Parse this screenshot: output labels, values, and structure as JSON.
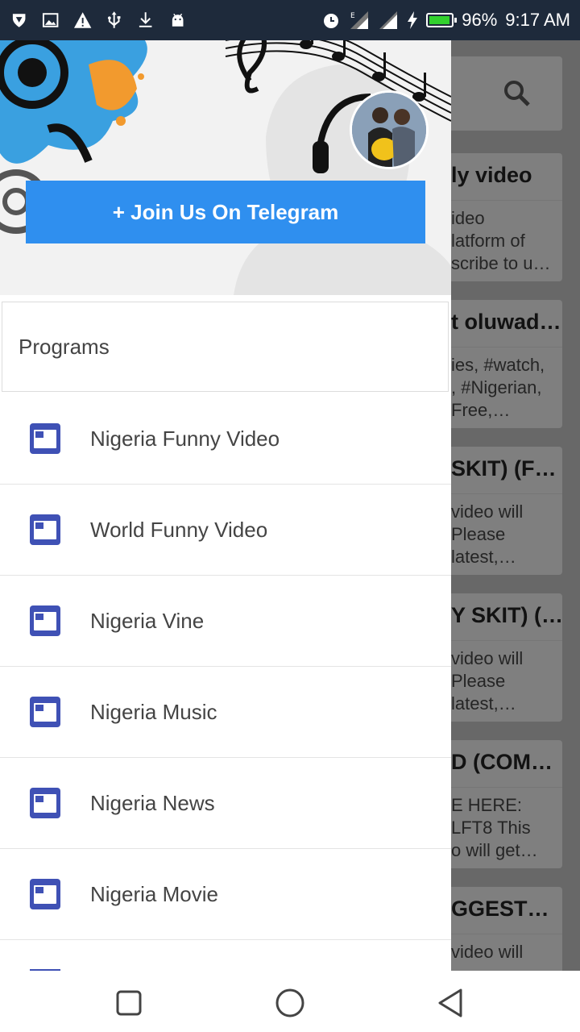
{
  "status_bar": {
    "battery_percent": "96%",
    "battery_level": 0.96,
    "time": "9:17 AM",
    "icons": [
      "vpn-icon",
      "image-icon",
      "warning-icon",
      "usb-icon",
      "download-icon",
      "android-icon",
      "alarm-icon",
      "signal-e-icon",
      "signal-icon",
      "charging-icon",
      "battery-icon"
    ]
  },
  "background": {
    "cards": [
      {
        "title": "ly video",
        "desc": "ideo\nlatform of\nscribe to u…"
      },
      {
        "title": "t oluwad…",
        "desc": "ies, #watch,\n, #Nigerian,\nFree,…"
      },
      {
        "title": "SKIT) (F…",
        "desc": "video will\nPlease\nlatest,…"
      },
      {
        "title": "Y SKIT) (…",
        "desc": "video will\nPlease\nlatest,…"
      },
      {
        "title": "D (COM…",
        "desc": "E HERE:\nLFT8 This\no will get…"
      },
      {
        "title": "GGEST…",
        "desc": "video will"
      }
    ]
  },
  "drawer": {
    "telegram_button": "+ Join Us On Telegram",
    "section_title": "Programs",
    "items": [
      {
        "label": "Nigeria Funny Video",
        "icon": "window-icon"
      },
      {
        "label": "World Funny Video",
        "icon": "window-icon"
      },
      {
        "label": "Nigeria Vine",
        "icon": "window-icon"
      },
      {
        "label": "Nigeria Music",
        "icon": "window-icon"
      },
      {
        "label": "Nigeria News",
        "icon": "window-icon"
      },
      {
        "label": "Nigeria Movie",
        "icon": "window-icon"
      }
    ]
  },
  "nav_bar": {
    "buttons": [
      "recents-icon",
      "home-icon",
      "back-icon"
    ]
  },
  "colors": {
    "accent": "#2f8fef",
    "menu_icon": "#3f51b5",
    "status_bar": "#1e2a3b",
    "battery": "#32d12e"
  }
}
